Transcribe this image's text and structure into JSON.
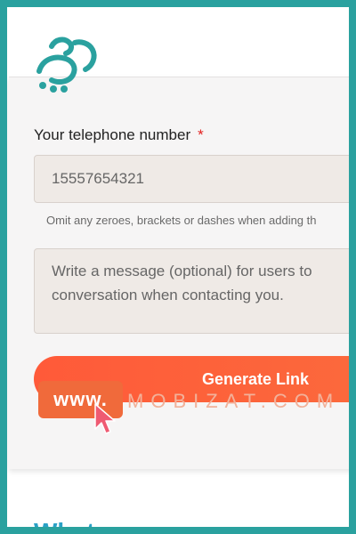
{
  "logo": {
    "name": "logo-icon",
    "color": "#2aa19f"
  },
  "form": {
    "phone_label": "Your telephone number",
    "required_mark": "*",
    "phone_value": "15557654321",
    "hint": "Omit any zeroes, brackets or dashes when adding th",
    "message_placeholder_line1": "Write a message (optional) for users to",
    "message_placeholder_line2": "conversation when contacting you.",
    "generate_button": "Generate Link"
  },
  "watermark": {
    "badge": "www.",
    "text": "MOBIZAT.COM"
  },
  "bottom": {
    "heading": "What... ..."
  },
  "colors": {
    "frame": "#2aa19f",
    "button": "#fb6a3c",
    "required": "#e3211f",
    "heading": "#2aa1c6"
  }
}
